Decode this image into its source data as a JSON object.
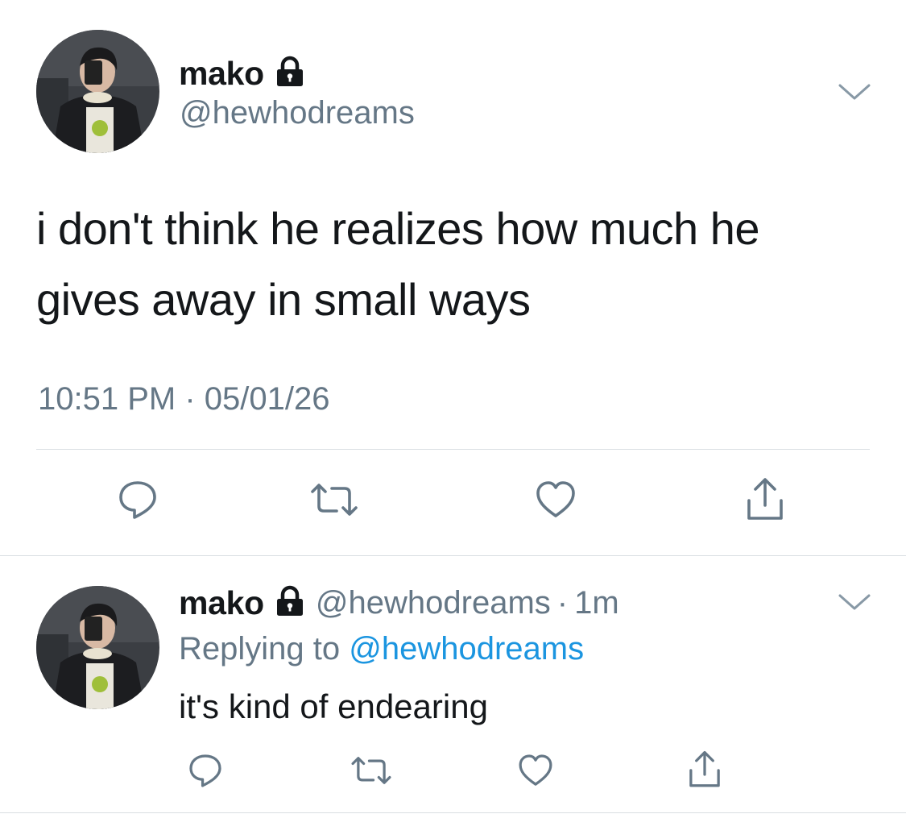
{
  "tweet": {
    "display_name": "mako",
    "handle": "@hewhodreams",
    "text": "i don't think he realizes how much he gives away in small ways",
    "time": "10:51 PM",
    "meta_separator": "·",
    "date": "05/01/26",
    "icons": {
      "lock": "lock-icon",
      "menu": "chevron-down-icon",
      "reply": "reply-icon",
      "retweet": "retweet-icon",
      "like": "heart-icon",
      "share": "share-icon"
    }
  },
  "reply": {
    "display_name": "mako",
    "handle": "@hewhodreams",
    "separator": "·",
    "time_ago": "1m",
    "replying_prefix": "Replying to",
    "replying_to": "@hewhodreams",
    "text": "it's kind of endearing"
  },
  "colors": {
    "primary_text": "#14171a",
    "secondary_text": "#657786",
    "link": "#1b95e0",
    "divider": "#d9dee2",
    "icon": "#657786"
  }
}
